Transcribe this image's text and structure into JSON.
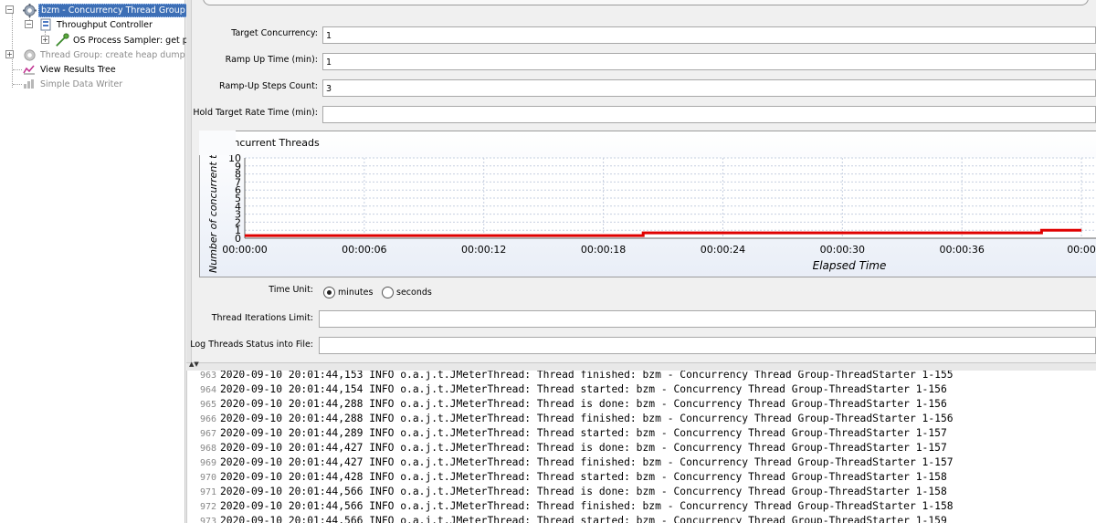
{
  "tree": {
    "items": [
      {
        "label": "bzm - Concurrency Thread Group",
        "selected": true,
        "disabled": false
      },
      {
        "label": "Throughput Controller",
        "selected": false,
        "disabled": false
      },
      {
        "label": "OS Process Sampler: get p",
        "selected": false,
        "disabled": false
      },
      {
        "label": "Thread Group: create heap dump",
        "selected": false,
        "disabled": true
      },
      {
        "label": "View Results Tree",
        "selected": false,
        "disabled": false
      },
      {
        "label": "Simple Data Writer",
        "selected": false,
        "disabled": true
      }
    ]
  },
  "form": {
    "target_concurrency": {
      "label": "Target Concurrency:",
      "value": "1"
    },
    "ramp_up_time": {
      "label": "Ramp Up Time (min):",
      "value": "1"
    },
    "ramp_up_steps": {
      "label": "Ramp-Up Steps Count:",
      "value": "3"
    },
    "hold_target": {
      "label": "Hold Target Rate Time (min):",
      "value": ""
    },
    "time_unit": {
      "label": "Time Unit:",
      "options": [
        "minutes",
        "seconds"
      ],
      "selected": "minutes"
    },
    "thread_iterations": {
      "label": "Thread Iterations Limit:",
      "value": ""
    },
    "log_threads": {
      "label": "Log Threads Status into File:",
      "value": ""
    }
  },
  "chart_data": {
    "type": "line",
    "legend": "Concurrent Threads",
    "ylabel": "Number of concurrent threads",
    "xlabel": "Elapsed Time",
    "ylim": [
      0,
      10
    ],
    "yticks": [
      0,
      1,
      2,
      3,
      4,
      5,
      6,
      7,
      8,
      9,
      10
    ],
    "xlim": [
      0,
      42
    ],
    "xticks": [
      {
        "t": 0,
        "label": "00:00:00"
      },
      {
        "t": 6,
        "label": "00:00:06"
      },
      {
        "t": 12,
        "label": "00:00:12"
      },
      {
        "t": 18,
        "label": "00:00:18"
      },
      {
        "t": 24,
        "label": "00:00:24"
      },
      {
        "t": 30,
        "label": "00:00:30"
      },
      {
        "t": 36,
        "label": "00:00:36"
      },
      {
        "t": 42,
        "label": "00:00"
      }
    ],
    "series": [
      {
        "color": "#e00000",
        "points": [
          [
            0,
            0.33
          ],
          [
            20,
            0.33
          ],
          [
            20,
            0.67
          ],
          [
            40,
            0.67
          ],
          [
            40,
            1.0
          ],
          [
            42,
            1.0
          ]
        ]
      }
    ],
    "grid": true
  },
  "log": {
    "lines": [
      {
        "num": "963",
        "text": "2020-09-10 20:01:44,153 INFO o.a.j.t.JMeterThread: Thread finished: bzm - Concurrency Thread Group-ThreadStarter 1-155"
      },
      {
        "num": "964",
        "text": "2020-09-10 20:01:44,154 INFO o.a.j.t.JMeterThread: Thread started: bzm - Concurrency Thread Group-ThreadStarter 1-156"
      },
      {
        "num": "965",
        "text": "2020-09-10 20:01:44,288 INFO o.a.j.t.JMeterThread: Thread is done: bzm - Concurrency Thread Group-ThreadStarter 1-156"
      },
      {
        "num": "966",
        "text": "2020-09-10 20:01:44,288 INFO o.a.j.t.JMeterThread: Thread finished: bzm - Concurrency Thread Group-ThreadStarter 1-156"
      },
      {
        "num": "967",
        "text": "2020-09-10 20:01:44,289 INFO o.a.j.t.JMeterThread: Thread started: bzm - Concurrency Thread Group-ThreadStarter 1-157"
      },
      {
        "num": "968",
        "text": "2020-09-10 20:01:44,427 INFO o.a.j.t.JMeterThread: Thread is done: bzm - Concurrency Thread Group-ThreadStarter 1-157"
      },
      {
        "num": "969",
        "text": "2020-09-10 20:01:44,427 INFO o.a.j.t.JMeterThread: Thread finished: bzm - Concurrency Thread Group-ThreadStarter 1-157"
      },
      {
        "num": "970",
        "text": "2020-09-10 20:01:44,428 INFO o.a.j.t.JMeterThread: Thread started: bzm - Concurrency Thread Group-ThreadStarter 1-158"
      },
      {
        "num": "971",
        "text": "2020-09-10 20:01:44,566 INFO o.a.j.t.JMeterThread: Thread is done: bzm - Concurrency Thread Group-ThreadStarter 1-158"
      },
      {
        "num": "972",
        "text": "2020-09-10 20:01:44,566 INFO o.a.j.t.JMeterThread: Thread finished: bzm - Concurrency Thread Group-ThreadStarter 1-158"
      },
      {
        "num": "973",
        "text": "2020-09-10 20:01:44,566 INFO o.a.j.t.JMeterThread: Thread started: bzm - Concurrency Thread Group-ThreadStarter 1-159"
      }
    ]
  }
}
